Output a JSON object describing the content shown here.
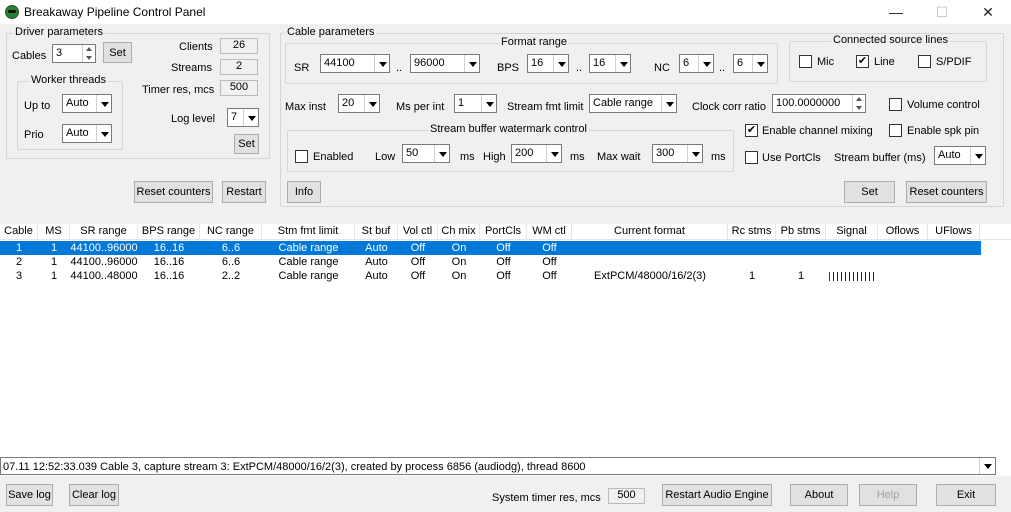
{
  "window": {
    "title": "Breakaway Pipeline Control Panel",
    "minimize": "—",
    "maximize": "☐",
    "close": "✕"
  },
  "driver": {
    "group": "Driver parameters",
    "cables_label": "Cables",
    "cables_value": "3",
    "set": "Set",
    "clients_label": "Clients",
    "clients_value": "26",
    "streams_label": "Streams",
    "streams_value": "2",
    "timer_label": "Timer res, mcs",
    "timer_value": "500",
    "worker_group": "Worker threads",
    "upto_label": "Up to",
    "upto_value": "Auto",
    "prio_label": "Prio",
    "prio_value": "Auto",
    "loglevel_label": "Log level",
    "loglevel_value": "7",
    "set2": "Set",
    "reset_counters": "Reset counters",
    "restart": "Restart"
  },
  "cable": {
    "group": "Cable parameters",
    "format_group": "Format range",
    "sr_label": "SR",
    "sr_min": "44100",
    "sr_max": "96000",
    "range_sep": "..",
    "bps_label": "BPS",
    "bps_min": "16",
    "bps_max": "16",
    "nc_label": "NC",
    "nc_min": "6",
    "nc_max": "6",
    "sources_group": "Connected source lines",
    "mic": "Mic",
    "mic_checked": false,
    "line": "Line",
    "line_checked": true,
    "spdif": "S/PDIF",
    "spdif_checked": false,
    "maxinst_label": "Max inst",
    "maxinst_value": "20",
    "msperint_label": "Ms per int",
    "msperint_value": "1",
    "sfl_label": "Stream fmt limit",
    "sfl_value": "Cable range",
    "clock_label": "Clock corr ratio",
    "clock_value": "100.0000000",
    "volume_label": "Volume control",
    "volume_checked": false,
    "wm_group": "Stream buffer watermark control",
    "enabled_label": "Enabled",
    "enabled_checked": false,
    "low_label": "Low",
    "low_value": "50",
    "ms": "ms",
    "high_label": "High",
    "high_value": "200",
    "maxwait_label": "Max wait",
    "maxwait_value": "300",
    "mixing_label": "Enable channel mixing",
    "mixing_checked": true,
    "spkpin_label": "Enable spk pin",
    "spkpin_checked": false,
    "portcls_label": "Use PortCls",
    "portcls_checked": false,
    "sbuf_label": "Stream buffer (ms)",
    "sbuf_value": "Auto",
    "info": "Info",
    "set": "Set",
    "reset_counters": "Reset counters"
  },
  "table": {
    "headers": [
      "Cable",
      "MS",
      "SR range",
      "BPS range",
      "NC range",
      "Stm fmt limit",
      "St buf",
      "Vol ctl",
      "Ch mix",
      "PortCls",
      "WM ctl",
      "Current format",
      "Rc stms",
      "Pb stms",
      "Signal",
      "Oflows",
      "UFlows"
    ],
    "rows": [
      [
        "1",
        "1",
        "44100..96000",
        "16..16",
        "6..6",
        "Cable range",
        "Auto",
        "Off",
        "On",
        "Off",
        "Off",
        "",
        "",
        "",
        "",
        "",
        ""
      ],
      [
        "2",
        "1",
        "44100..96000",
        "16..16",
        "6..6",
        "Cable range",
        "Auto",
        "Off",
        "On",
        "Off",
        "Off",
        "",
        "",
        "",
        "",
        "",
        ""
      ],
      [
        "3",
        "1",
        "44100..48000",
        "16..16",
        "2..2",
        "Cable range",
        "Auto",
        "Off",
        "On",
        "Off",
        "Off",
        "ExtPCM/48000/16/2(3)",
        "1",
        "1",
        "",
        "",
        ""
      ]
    ],
    "selected_row": 0,
    "signal_row": 2,
    "signal_level": 0.1
  },
  "log": {
    "text": "07.11 12:52:33.039 Cable 3, capture stream 3: ExtPCM/48000/16/2(3), created by process 6856 (audiodg), thread 8600"
  },
  "bottom": {
    "save_log": "Save log",
    "clear_log": "Clear log",
    "systimer_label": "System timer res, mcs",
    "systimer_value": "500",
    "restart_engine": "Restart Audio Engine",
    "about": "About",
    "help": "Help",
    "exit": "Exit"
  }
}
